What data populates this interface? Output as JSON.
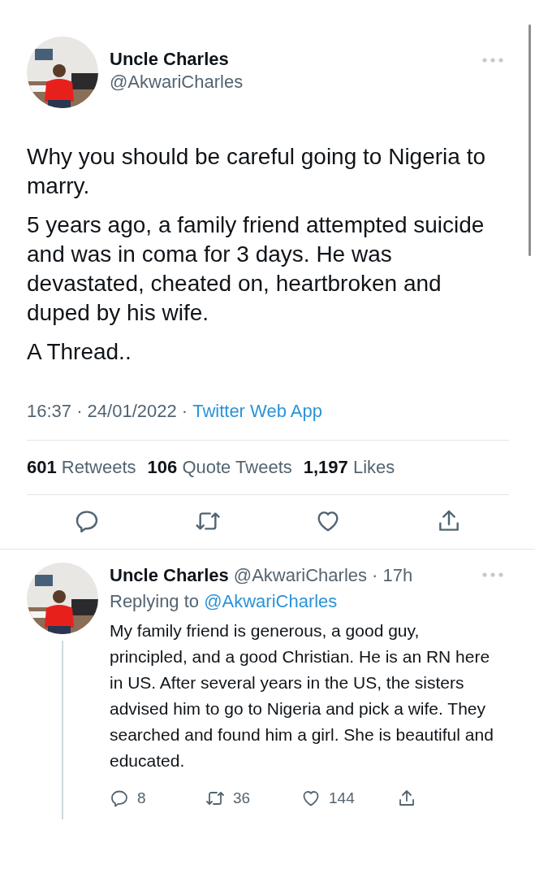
{
  "tweet": {
    "name": "Uncle Charles",
    "handle": "@AkwariCharles",
    "paragraphs": [
      "Why you should be careful going to Nigeria to marry.",
      "5 years ago, a family friend attempted suicide and was in coma for 3 days. He was devastated, cheated on, heartbroken and duped by his wife.",
      "A Thread.."
    ],
    "meta": "16:37 · 24/01/2022 ·",
    "source": "Twitter Web App",
    "stats": [
      {
        "count": "601",
        "label": "Retweets"
      },
      {
        "count": "106",
        "label": "Quote Tweets"
      },
      {
        "count": "1,197",
        "label": "Likes"
      }
    ],
    "actions": [
      {
        "kind": "reply"
      },
      {
        "kind": "retweet"
      },
      {
        "kind": "like"
      },
      {
        "kind": "share"
      }
    ]
  },
  "reply": {
    "name": "Uncle Charles",
    "meta": "@AkwariCharles · 17h",
    "replying_label": "Replying to",
    "replying_handle": "@AkwariCharles",
    "text": "My family friend is generous, a good guy, principled, and a good Christian. He is an RN here in US. After several years in the US, the sisters advised him to go to Nigeria and pick a wife. They searched and found him a girl. She is beautiful and educated.",
    "actions": [
      {
        "kind": "reply",
        "count": "8"
      },
      {
        "kind": "retweet",
        "count": "36"
      },
      {
        "kind": "like",
        "count": "144"
      },
      {
        "kind": "share"
      }
    ]
  }
}
